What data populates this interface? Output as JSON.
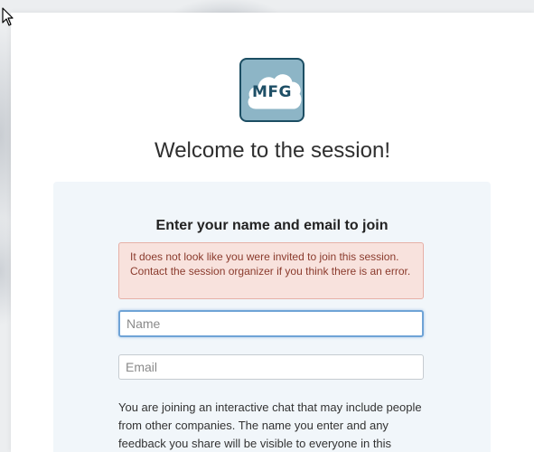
{
  "logo": {
    "text": "MFG",
    "icon": "cloud-logo-icon"
  },
  "welcome_title": "Welcome to the session!",
  "form": {
    "heading": "Enter your name and email to join",
    "alert": "It does not look like you were invited to join this session. Contact the session organizer if you think there is an error.",
    "name_placeholder": "Name",
    "email_placeholder": "Email",
    "disclaimer": "You are joining an interactive chat that may include people from other companies. The name you enter and any feedback you share will be visible to everyone in this session. Leave"
  },
  "colors": {
    "logo_fill": "#8db5c6",
    "logo_border": "#1c4e63",
    "alert_bg": "#f8e2dd",
    "alert_text": "#8a3a2c",
    "focus_ring": "#6fa3d6"
  }
}
